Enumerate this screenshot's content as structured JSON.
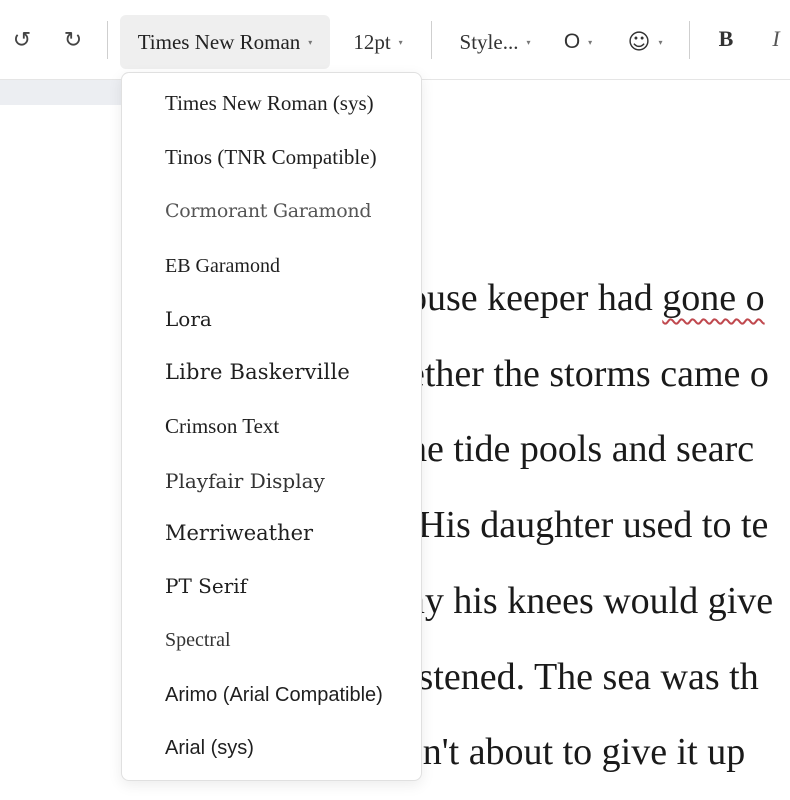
{
  "toolbar": {
    "undo_icon": "↺",
    "redo_icon": "↻",
    "font_value": "Times New Roman",
    "size_value": "12pt",
    "style_value": "Style...",
    "o_value": "O",
    "emoji_value": "☺",
    "caret": "▾",
    "bold_label": "B",
    "italic_label": "I"
  },
  "font_menu": {
    "items": [
      "Times New Roman (sys)",
      "Tinos (TNR Compatible)",
      "Cormorant Garamond",
      "EB Garamond",
      "Lora",
      "Libre Baskerville",
      "Crimson Text",
      "Playfair Display",
      "Merriweather",
      "PT Serif",
      "Spectral",
      "Arimo (Arial Compatible)",
      "Arial (sys)"
    ]
  },
  "document": {
    "lines": [
      {
        "before": "ouse keeper had ",
        "spell": "gone o",
        "after": ""
      },
      {
        "before": "ether the storms came o",
        "spell": "",
        "after": ""
      },
      {
        "before": "he tide pools and searc",
        "spell": "",
        "after": ""
      },
      {
        "before": " His daughter used to te",
        "spell": "",
        "after": ""
      },
      {
        "before": "ay his knees would give",
        "spell": "",
        "after": ""
      },
      {
        "before": "istened. The sea was th",
        "spell": "",
        "after": ""
      },
      {
        "before": "sn't about to give it up",
        "spell": "",
        "after": ""
      }
    ]
  }
}
